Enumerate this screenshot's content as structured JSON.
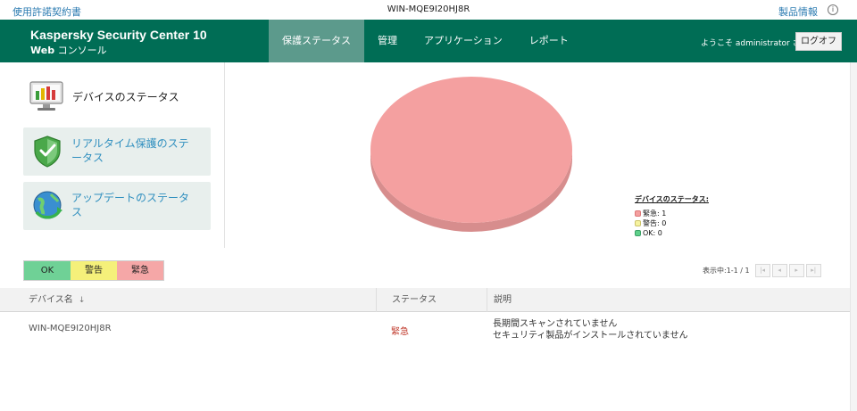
{
  "topbar": {
    "eula_link": "使用許諾契約書",
    "host_name": "WIN-MQE9I20HJ8R",
    "product_info_link": "製品情報",
    "info_glyph": "i"
  },
  "header": {
    "brand_line1": "Kaspersky Security Center 10",
    "brand_line2_bold": "Web",
    "brand_line2_rest": " コンソール",
    "nav": [
      {
        "label": "保護ステータス",
        "active": true
      },
      {
        "label": "管理",
        "active": false
      },
      {
        "label": "アプリケーション",
        "active": false
      },
      {
        "label": "レポート",
        "active": false
      }
    ],
    "welcome": "ようこそ administrator さん",
    "logoff_label": "ログオフ",
    "colors": {
      "bar": "#006d55",
      "active_tab": "#5c9a8c"
    }
  },
  "sidebar": {
    "title": "デバイスのステータス",
    "title_icon": "monitor-chart-icon",
    "items": [
      {
        "label": "リアルタイム保護のステータス",
        "icon": "shield-check-icon"
      },
      {
        "label": "アップデートのステータス",
        "icon": "globe-update-icon"
      }
    ]
  },
  "chart_data": {
    "type": "pie",
    "categories": [
      "緊急",
      "警告",
      "OK"
    ],
    "values": [
      1,
      0,
      0
    ],
    "colors": [
      "#f4a0a0",
      "#f6f3a0",
      "#5fd08a"
    ],
    "legend_title": "デバイスのステータス:",
    "legend_items": [
      "緊急: 1",
      "警告: 0",
      "OK: 0"
    ],
    "legend_position": "right"
  },
  "filters": [
    {
      "label": "OK",
      "color": "#6fd196"
    },
    {
      "label": "警告",
      "color": "#f5f07a"
    },
    {
      "label": "緊急",
      "color": "#f5a7a7"
    }
  ],
  "pager": {
    "text": "表示中:1-1 / 1",
    "buttons": [
      "|◂",
      "◂",
      "▸",
      "▸|"
    ]
  },
  "table": {
    "headers": {
      "device": "デバイス名",
      "sort_glyph": "↓",
      "status": "ステータス",
      "description": "説明"
    },
    "rows": [
      {
        "device": "WIN-MQE9I20HJ8R",
        "status": "緊急",
        "status_color": "#c0392b",
        "description_line1": "長期間スキャンされていません",
        "description_line2": "セキュリティ製品がインストールされていません"
      }
    ]
  }
}
